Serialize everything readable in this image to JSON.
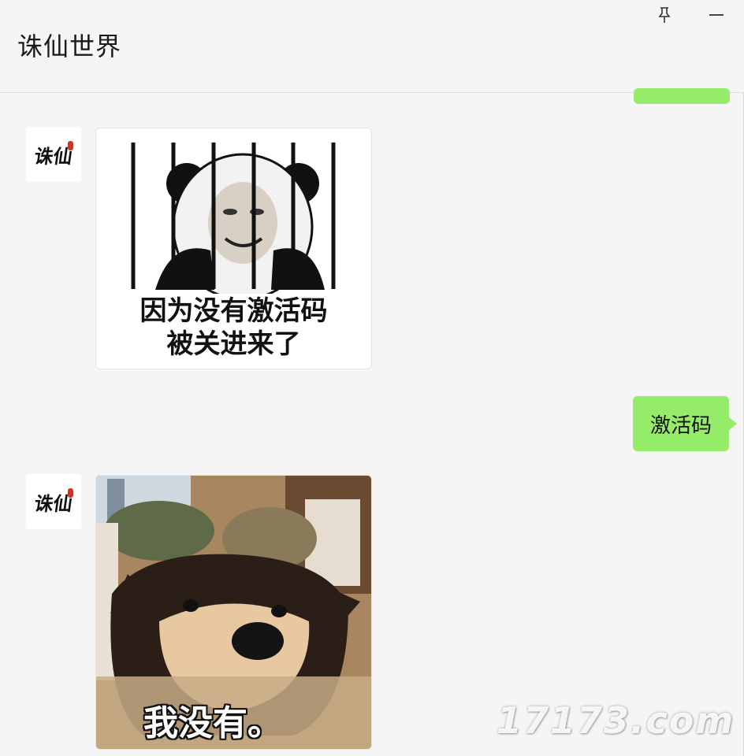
{
  "window": {
    "title": "诛仙世界",
    "pin_icon": "pin-icon",
    "minimize_icon": "minimize-icon"
  },
  "messages": [
    {
      "side": "right",
      "type": "text",
      "text": ""
    },
    {
      "side": "left",
      "type": "sticker",
      "avatar": "zhuxian-logo",
      "caption_lines": [
        "因为没有激活码",
        "被关进来了"
      ]
    },
    {
      "side": "right",
      "type": "text",
      "text": "激活码"
    },
    {
      "side": "left",
      "type": "sticker",
      "avatar": "zhuxian-logo",
      "caption_lines": [
        "我没有。"
      ]
    }
  ],
  "avatar": {
    "logo_text": "诛仙"
  },
  "watermark": "17173.com",
  "colors": {
    "bubble": "#95ec69",
    "background": "#f5f5f5"
  }
}
